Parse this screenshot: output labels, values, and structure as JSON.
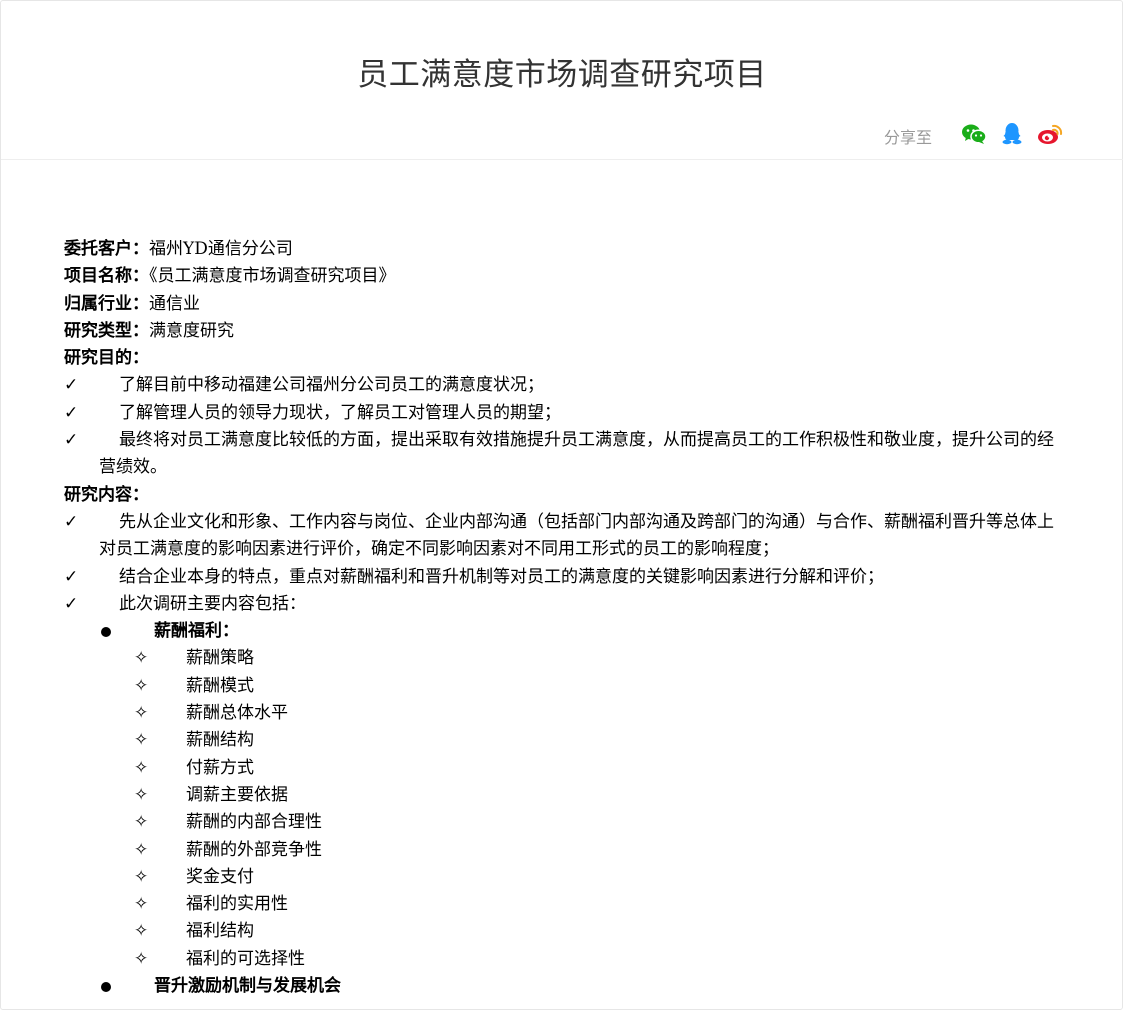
{
  "page": {
    "title": "员工满意度市场调查研究项目"
  },
  "share": {
    "label": "分享至",
    "icons": [
      "wechat-icon",
      "qq-icon",
      "weibo-icon"
    ],
    "colors": {
      "wechat": "#1aad19",
      "qq": "#1e96ff",
      "weibo": "#e6162d"
    }
  },
  "info": {
    "client_label": "委托客户：",
    "client_value": "福州YD通信分公司",
    "project_label": "项目名称：",
    "project_value": "《员工满意度市场调查研究项目》",
    "industry_label": "归属行业：",
    "industry_value": "通信业",
    "type_label": "研究类型：",
    "type_value": "满意度研究"
  },
  "purpose": {
    "heading": "研究目的：",
    "items": [
      "了解目前中移动福建公司福州分公司员工的满意度状况；",
      "了解管理人员的领导力现状，了解员工对管理人员的期望；",
      "最终将对员工满意度比较低的方面，提出采取有效措施提升员工满意度，从而提高员工的工作积极性和敬业度，提升公司的经营绩效。"
    ]
  },
  "content": {
    "heading": "研究内容：",
    "items": [
      "先从企业文化和形象、工作内容与岗位、企业内部沟通（包括部门内部沟通及跨部门的沟通）与合作、薪酬福利晋升等总体上对员工满意度的影响因素进行评价，确定不同影响因素对不同用工形式的员工的影响程度；",
      "结合企业本身的特点，重点对薪酬福利和晋升机制等对员工的满意度的关键影响因素进行分解和评价；",
      "此次调研主要内容包括："
    ],
    "check_mark": "✓",
    "star_mark": "✧",
    "sections": [
      {
        "title": "薪酬福利：",
        "items": [
          "薪酬策略",
          "薪酬模式",
          "薪酬总体水平",
          "薪酬结构",
          "付薪方式",
          "调薪主要依据",
          "薪酬的内部合理性",
          "薪酬的外部竞争性",
          "奖金支付",
          "福利的实用性",
          "福利结构",
          "福利的可选择性"
        ]
      },
      {
        "title": "晋升激励机制与发展机会"
      }
    ]
  }
}
